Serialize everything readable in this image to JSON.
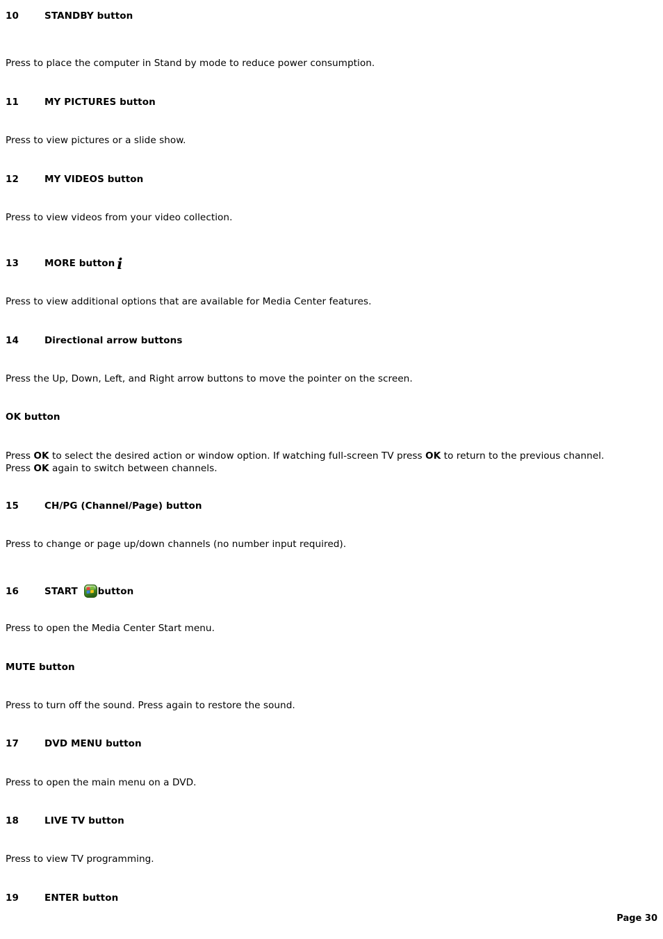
{
  "document": {
    "type": "user-guide-page",
    "page_label": "Page 30",
    "background_color": "#ffffff",
    "text_color": "#000000"
  },
  "sections": [
    {
      "number": "10",
      "title": "STANDBY button",
      "body": "Press to place the computer in Stand by mode to reduce power consumption."
    },
    {
      "number": "11",
      "title": "MY PICTURES button",
      "body": "Press to view pictures or a slide show."
    },
    {
      "number": "12",
      "title": "MY VIDEOS button",
      "body": "Press to view videos from your video collection."
    },
    {
      "number": "13",
      "title": "MORE button",
      "icon": "more-info-i-icon",
      "icon_glyph": "i",
      "body": "Press to view additional options that are available for Media Center features."
    },
    {
      "number": "14",
      "title": "Directional arrow buttons",
      "body": "Press the Up, Down, Left, and Right arrow buttons to move the pointer on the screen."
    },
    {
      "number": "",
      "title": "OK button",
      "body_parts": [
        {
          "text": "Press ",
          "bold": false
        },
        {
          "text": "OK",
          "bold": true
        },
        {
          "text": " to select the desired action or window option. If watching full-screen TV press ",
          "bold": false
        },
        {
          "text": "OK",
          "bold": true
        },
        {
          "text": " to return to the previous channel. Press ",
          "bold": false
        },
        {
          "text": "OK",
          "bold": true
        },
        {
          "text": " again to switch between channels.",
          "bold": false
        }
      ]
    },
    {
      "number": "15",
      "title": "CH/PG (Channel/Page) button",
      "body": "Press to change or page up/down channels (no number input required)."
    },
    {
      "number": "16",
      "title_prefix": "START ",
      "title_suffix": "button",
      "icon": "windows-start-orb-icon",
      "body": "Press to open the Media Center Start menu."
    },
    {
      "number": "",
      "title": "MUTE button",
      "body": "Press to turn off the sound. Press again to restore the sound."
    },
    {
      "number": "17",
      "title": "DVD MENU button",
      "body": "Press to open the main menu on a DVD."
    },
    {
      "number": "18",
      "title": "LIVE TV button",
      "body": "Press to view TV programming."
    },
    {
      "number": "19",
      "title": "ENTER button",
      "body": ""
    }
  ],
  "s10": {
    "num": "10",
    "title": "STANDBY button",
    "body": "Press to place the computer in Stand by mode to reduce power consumption."
  },
  "s11": {
    "num": "11",
    "title": "MY PICTURES button",
    "body": "Press to view pictures or a slide show."
  },
  "s12": {
    "num": "12",
    "title": "MY VIDEOS button",
    "body": "Press to view videos from your video collection."
  },
  "s13": {
    "num": "13",
    "title": "MORE button",
    "icon_glyph": "i",
    "body": "Press to view additional options that are available for Media Center features."
  },
  "s14": {
    "num": "14",
    "title": "Directional arrow buttons",
    "body": "Press the Up, Down, Left, and Right arrow buttons to move the pointer on the screen."
  },
  "sok": {
    "title": "OK button",
    "p1": "Press ",
    "b1": "OK",
    "p2": " to select the desired action or window option. If watching full-screen TV press ",
    "b2": "OK",
    "p3": " to return to the previous channel. Press ",
    "b3": "OK",
    "p4": " again to switch between channels."
  },
  "s15": {
    "num": "15",
    "title": "CH/PG (Channel/Page) button",
    "body": "Press to change or page up/down channels (no number input required)."
  },
  "s16": {
    "num": "16",
    "title_prefix": "START ",
    "title_suffix": "button",
    "body": "Press to open the Media Center Start menu."
  },
  "smute": {
    "title": "MUTE button",
    "body": "Press to turn off the sound. Press again to restore the sound."
  },
  "s17": {
    "num": "17",
    "title": "DVD MENU button",
    "body": "Press to open the main menu on a DVD."
  },
  "s18": {
    "num": "18",
    "title": "LIVE TV button",
    "body": "Press to view TV programming."
  },
  "s19": {
    "num": "19",
    "title": "ENTER button"
  },
  "footer": {
    "page_label": "Page 30"
  },
  "colors": {
    "start_orb_green_light": "#8fd14f",
    "start_orb_green_mid": "#4c9a2a",
    "start_orb_green_dark": "#2f6b18",
    "flag_red": "#e8403a",
    "flag_green": "#7bbf3a",
    "flag_blue": "#3d7fd6",
    "flag_yellow": "#f5c518",
    "text": "#000000",
    "background": "#ffffff"
  }
}
